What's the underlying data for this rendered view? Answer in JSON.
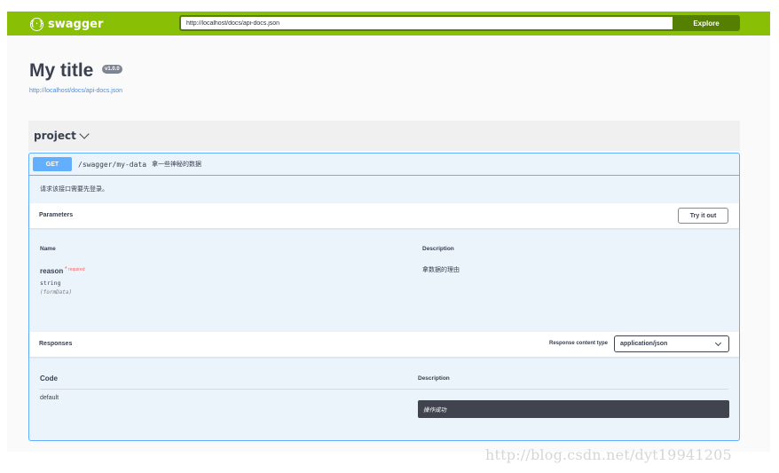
{
  "topbar": {
    "logo_glyph": "{·}",
    "logo_text": "swagger",
    "url_value": "http://localhost/docs/api-docs.json",
    "explore_label": "Explore",
    "bg_color": "#89bf04"
  },
  "info": {
    "title": "My title",
    "version": "v1.0.0",
    "spec_url": "http://localhost/docs/api-docs.json"
  },
  "tag": {
    "name": "project",
    "icon": "chevron-down-icon"
  },
  "operation": {
    "method": "GET",
    "path": "/swagger/my-data",
    "summary": "拿一些神秘的数据",
    "description": "请求该接口需要先登录。",
    "method_color": "#61affe",
    "parameters": {
      "title": "Parameters",
      "try_label": "Try it out",
      "col_name": "Name",
      "col_description": "Description",
      "items": [
        {
          "name": "reason",
          "required_label": "required",
          "type": "string",
          "in": "(formData)",
          "description": "拿数据的理由"
        }
      ]
    },
    "responses": {
      "title": "Responses",
      "content_type_label": "Response content type",
      "content_type_value": "application/json",
      "col_code": "Code",
      "col_description": "Description",
      "items": [
        {
          "code": "default",
          "description": "操作成功"
        }
      ]
    }
  },
  "watermark": "http://blog.csdn.net/dyt19941205"
}
